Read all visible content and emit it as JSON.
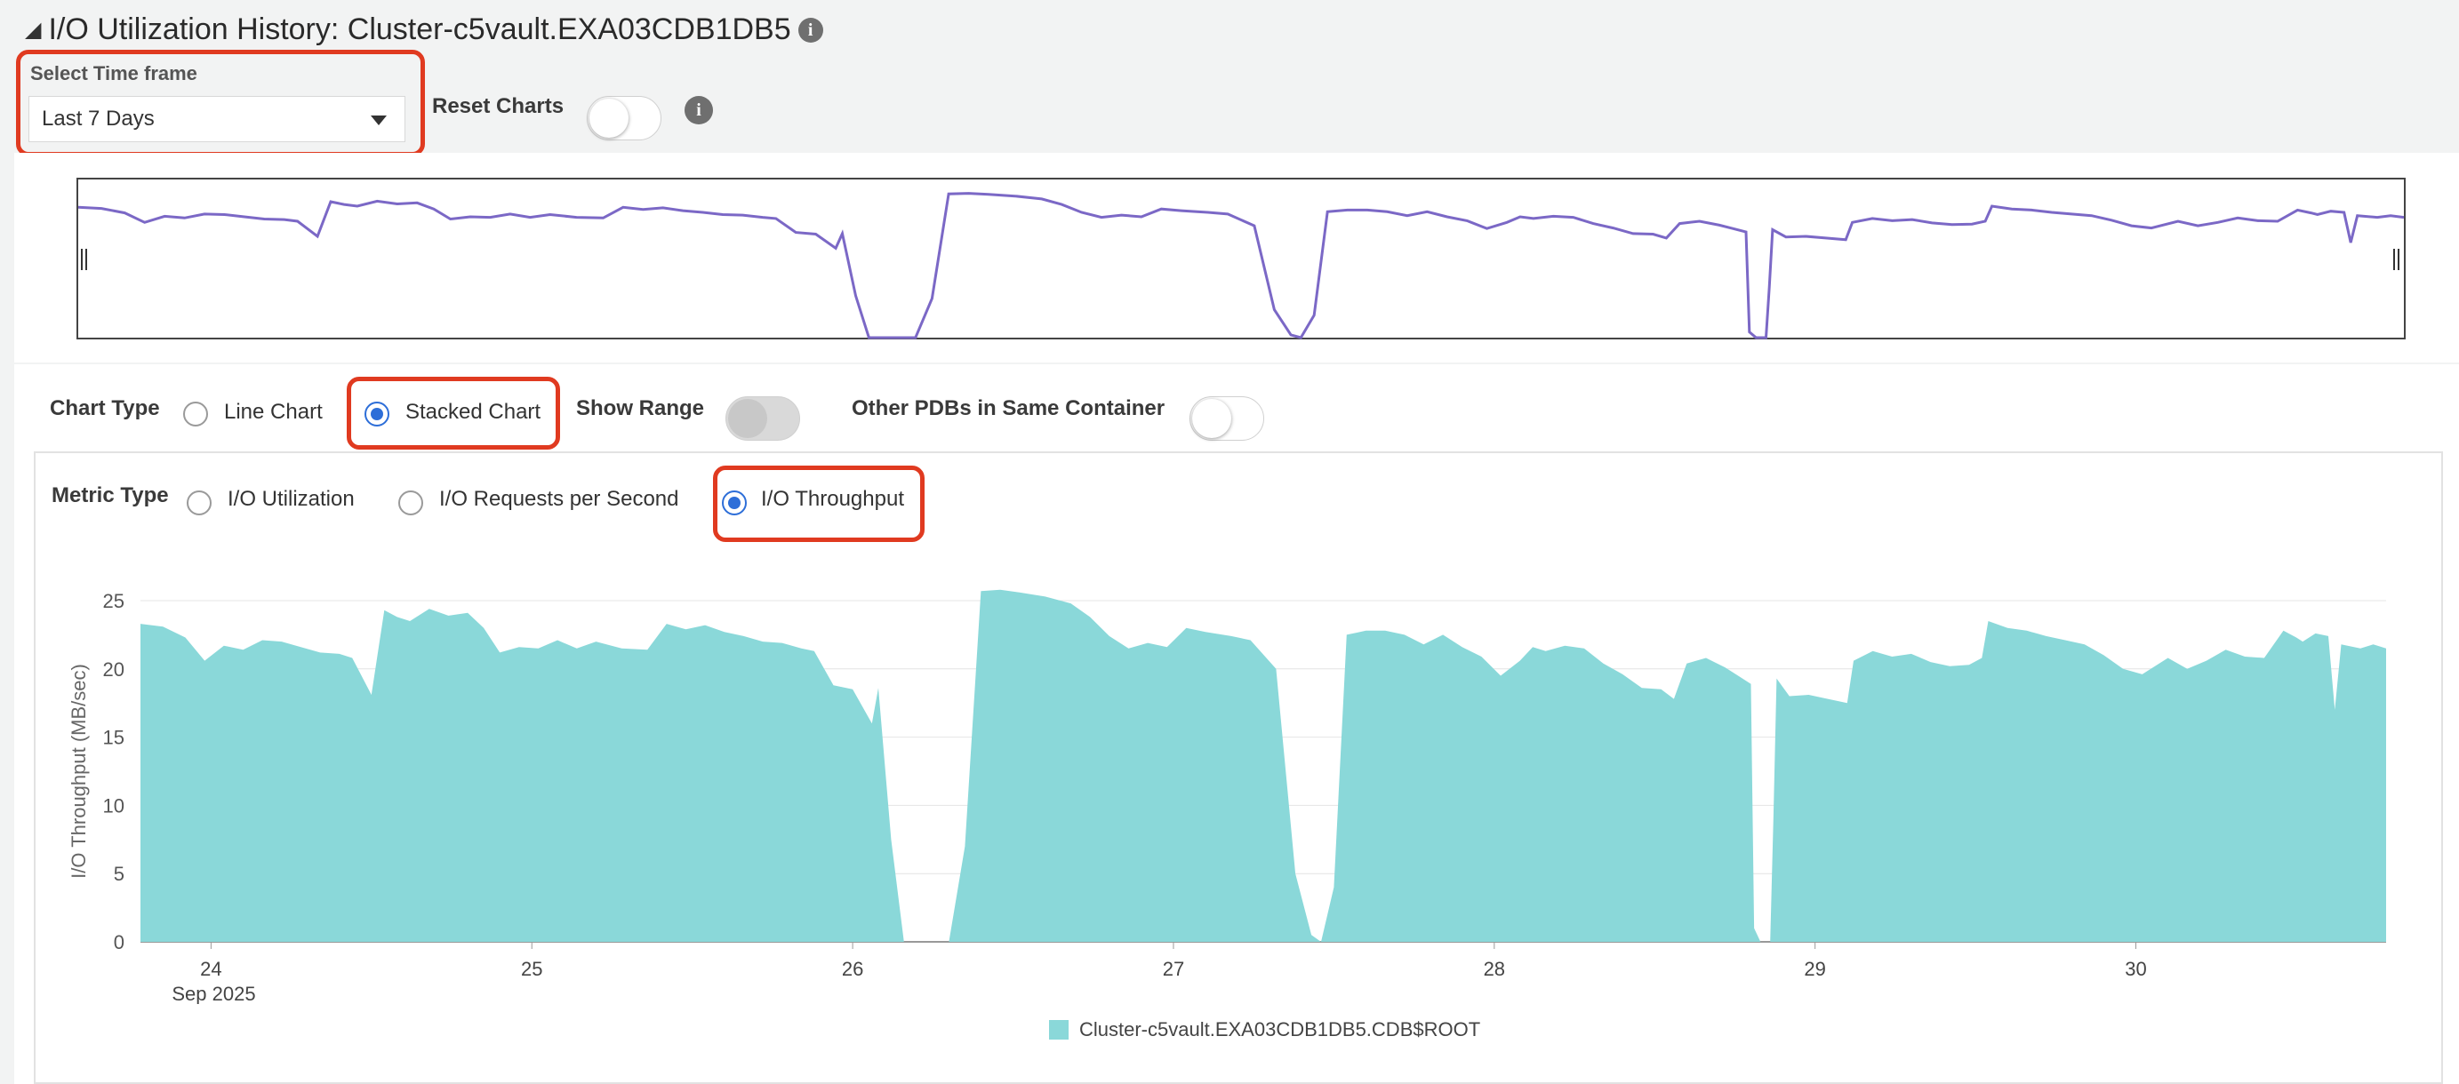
{
  "header": {
    "title": "I/O Utilization History: Cluster-c5vault.EXA03CDB1DB5",
    "info_icon": "info-icon"
  },
  "timeframe": {
    "label": "Select Time frame",
    "value": "Last 7 Days"
  },
  "reset": {
    "label": "Reset Charts",
    "checked": false
  },
  "chart_type": {
    "label": "Chart Type",
    "options": [
      "Line Chart",
      "Stacked Chart"
    ],
    "selected": "Stacked Chart"
  },
  "show_range": {
    "label": "Show Range",
    "checked": false,
    "disabled": true
  },
  "other_pdbs": {
    "label": "Other PDBs in Same Container",
    "checked": false
  },
  "metric_type": {
    "label": "Metric Type",
    "options": [
      "I/O Utilization",
      "I/O Requests per Second",
      "I/O Throughput"
    ],
    "selected": "I/O Throughput"
  },
  "colors": {
    "area": "#8ad8d9",
    "overview_line": "#7b68c6",
    "highlight": "#e03a20",
    "radio": "#2d6ed8"
  },
  "chart_data": {
    "type": "area",
    "ylabel": "I/O Throughput (MB/sec)",
    "ylim": [
      0,
      25
    ],
    "yticks": [
      0,
      5,
      10,
      15,
      20,
      25
    ],
    "xticks": [
      "24",
      "25",
      "26",
      "27",
      "28",
      "29",
      "30"
    ],
    "xtick_sub": "Sep 2025",
    "xlim": [
      23.78,
      30.78
    ],
    "grid": true,
    "legend_position": "bottom",
    "series": [
      {
        "name": "Cluster-c5vault.EXA03CDB1DB5.CDB$ROOT",
        "points": [
          [
            23.78,
            23.3
          ],
          [
            23.85,
            23.1
          ],
          [
            23.92,
            22.3
          ],
          [
            23.98,
            20.6
          ],
          [
            24.04,
            21.7
          ],
          [
            24.1,
            21.4
          ],
          [
            24.16,
            22.1
          ],
          [
            24.22,
            22.0
          ],
          [
            24.28,
            21.6
          ],
          [
            24.34,
            21.2
          ],
          [
            24.4,
            21.1
          ],
          [
            24.44,
            20.8
          ],
          [
            24.5,
            18.1
          ],
          [
            24.54,
            24.3
          ],
          [
            24.58,
            23.8
          ],
          [
            24.62,
            23.5
          ],
          [
            24.68,
            24.4
          ],
          [
            24.74,
            23.9
          ],
          [
            24.8,
            24.1
          ],
          [
            24.85,
            23.0
          ],
          [
            24.9,
            21.2
          ],
          [
            24.96,
            21.6
          ],
          [
            25.02,
            21.5
          ],
          [
            25.08,
            22.1
          ],
          [
            25.14,
            21.5
          ],
          [
            25.2,
            22.0
          ],
          [
            25.28,
            21.5
          ],
          [
            25.36,
            21.4
          ],
          [
            25.42,
            23.3
          ],
          [
            25.48,
            22.9
          ],
          [
            25.54,
            23.2
          ],
          [
            25.6,
            22.7
          ],
          [
            25.66,
            22.4
          ],
          [
            25.72,
            22.0
          ],
          [
            25.78,
            21.9
          ],
          [
            25.84,
            21.5
          ],
          [
            25.88,
            21.3
          ],
          [
            25.94,
            18.8
          ],
          [
            26.0,
            18.5
          ],
          [
            26.06,
            16.0
          ],
          [
            26.08,
            18.6
          ],
          [
            26.12,
            7.5
          ],
          [
            26.16,
            0
          ],
          [
            26.3,
            0
          ],
          [
            26.35,
            7.0
          ],
          [
            26.4,
            25.7
          ],
          [
            26.46,
            25.8
          ],
          [
            26.52,
            25.6
          ],
          [
            26.6,
            25.3
          ],
          [
            26.68,
            24.8
          ],
          [
            26.74,
            23.8
          ],
          [
            26.8,
            22.4
          ],
          [
            26.86,
            21.5
          ],
          [
            26.92,
            21.9
          ],
          [
            26.98,
            21.6
          ],
          [
            27.04,
            23.0
          ],
          [
            27.1,
            22.7
          ],
          [
            27.18,
            22.4
          ],
          [
            27.24,
            22.1
          ],
          [
            27.32,
            20.0
          ],
          [
            27.38,
            5.0
          ],
          [
            27.43,
            0.5
          ],
          [
            27.46,
            0
          ],
          [
            27.5,
            4.0
          ],
          [
            27.54,
            22.5
          ],
          [
            27.6,
            22.8
          ],
          [
            27.66,
            22.8
          ],
          [
            27.72,
            22.5
          ],
          [
            27.78,
            21.8
          ],
          [
            27.84,
            22.5
          ],
          [
            27.9,
            21.6
          ],
          [
            27.96,
            20.9
          ],
          [
            28.02,
            19.5
          ],
          [
            28.08,
            20.6
          ],
          [
            28.12,
            21.6
          ],
          [
            28.16,
            21.3
          ],
          [
            28.22,
            21.7
          ],
          [
            28.28,
            21.5
          ],
          [
            28.34,
            20.4
          ],
          [
            28.4,
            19.6
          ],
          [
            28.46,
            18.6
          ],
          [
            28.52,
            18.5
          ],
          [
            28.56,
            17.8
          ],
          [
            28.6,
            20.4
          ],
          [
            28.66,
            20.8
          ],
          [
            28.72,
            20.1
          ],
          [
            28.76,
            19.5
          ],
          [
            28.8,
            18.9
          ],
          [
            28.81,
            1.0
          ],
          [
            28.83,
            0
          ],
          [
            28.86,
            0
          ],
          [
            28.87,
            9.0
          ],
          [
            28.88,
            19.3
          ],
          [
            28.92,
            18.0
          ],
          [
            28.98,
            18.1
          ],
          [
            29.04,
            17.8
          ],
          [
            29.1,
            17.5
          ],
          [
            29.12,
            20.6
          ],
          [
            29.18,
            21.3
          ],
          [
            29.24,
            20.9
          ],
          [
            29.3,
            21.1
          ],
          [
            29.36,
            20.5
          ],
          [
            29.42,
            20.2
          ],
          [
            29.48,
            20.3
          ],
          [
            29.52,
            20.8
          ],
          [
            29.54,
            23.5
          ],
          [
            29.6,
            23.0
          ],
          [
            29.66,
            22.8
          ],
          [
            29.72,
            22.4
          ],
          [
            29.78,
            22.1
          ],
          [
            29.84,
            21.8
          ],
          [
            29.9,
            21.0
          ],
          [
            29.96,
            20.0
          ],
          [
            30.02,
            19.6
          ],
          [
            30.1,
            20.8
          ],
          [
            30.16,
            20.0
          ],
          [
            30.22,
            20.6
          ],
          [
            30.28,
            21.4
          ],
          [
            30.34,
            20.9
          ],
          [
            30.4,
            20.8
          ],
          [
            30.46,
            22.8
          ],
          [
            30.5,
            22.3
          ],
          [
            30.52,
            22.0
          ],
          [
            30.56,
            22.6
          ],
          [
            30.6,
            22.4
          ],
          [
            30.62,
            17.0
          ],
          [
            30.64,
            21.8
          ],
          [
            30.7,
            21.5
          ],
          [
            30.74,
            21.8
          ],
          [
            30.78,
            21.5
          ]
        ]
      }
    ]
  }
}
